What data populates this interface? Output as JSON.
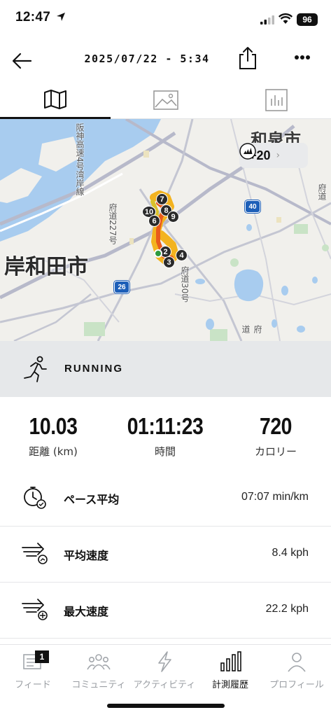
{
  "status_bar": {
    "time": "12:47",
    "battery": "96"
  },
  "header": {
    "title": "2025/07/22 - 5:34"
  },
  "tabs": [
    {
      "name": "map-tab",
      "icon": "map-icon",
      "active": true
    },
    {
      "name": "photos-tab",
      "icon": "image-icon",
      "active": false
    },
    {
      "name": "charts-tab",
      "icon": "bar-chart-icon",
      "active": false
    }
  ],
  "map": {
    "city_labels": {
      "kishiwada": "岸和田市",
      "izumi": "和泉市"
    },
    "road_labels": {
      "hanshin": "阪神高速4号湾岸線",
      "fudo227": "府道227号",
      "fudo30": "府道30号",
      "fudo_right": "府道",
      "fudo_right2": "府道"
    },
    "route_shields": {
      "r40": "40",
      "r26": "26"
    },
    "badge_count": "+20",
    "km_markers": [
      "7",
      "8",
      "9",
      "10",
      "6",
      "2",
      "3",
      "4"
    ]
  },
  "activity": {
    "type": "RUNNING"
  },
  "stats": [
    {
      "value": "10.03",
      "label": "距離 (km)"
    },
    {
      "value": "01:11:23",
      "label": "時間"
    },
    {
      "value": "720",
      "label": "カロリー"
    }
  ],
  "details": [
    {
      "label": "ペース平均",
      "value": "07:07 min/km",
      "icon": "stopwatch-pace-icon"
    },
    {
      "label": "平均速度",
      "value": "8.4 kph",
      "icon": "speed-average-icon"
    },
    {
      "label": "最大速度",
      "value": "22.2 kph",
      "icon": "speed-max-icon"
    }
  ],
  "bottom_nav": [
    {
      "label": "フィード",
      "badge": "1",
      "active": false
    },
    {
      "label": "コミュニティ",
      "active": false
    },
    {
      "label": "アクティビティ",
      "active": false
    },
    {
      "label": "計測履歴",
      "active": true
    },
    {
      "label": "プロフィール",
      "active": false
    }
  ],
  "colors": {
    "route_hot": "#e85a1c",
    "route_warm": "#f3b31f",
    "route_mid": "#d9c12a",
    "route_start": "#2f9a3e",
    "shield": "#1d5fb8",
    "water": "#a8ccef"
  }
}
